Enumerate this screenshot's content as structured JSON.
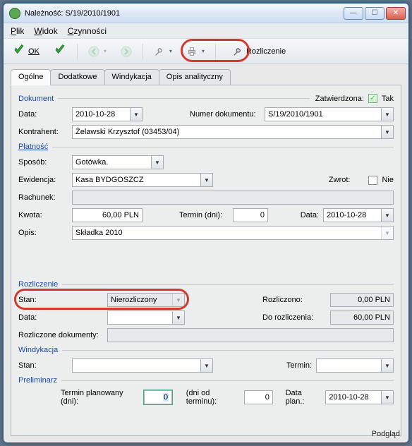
{
  "window": {
    "title": "Należność: S/19/2010/1901"
  },
  "menu": {
    "plik": "Plik",
    "widok": "Widok",
    "czynnosci": "Czynności"
  },
  "toolbar": {
    "ok": "OK",
    "rozliczenie": "Rozliczenie"
  },
  "tabs": {
    "ogolne": "Ogólne",
    "dodatkowe": "Dodatkowe",
    "windykacja": "Windykacja",
    "opis": "Opis analityczny"
  },
  "dokument": {
    "title": "Dokument",
    "zatw_label": "Zatwierdzona:",
    "zatw_tak": "Tak",
    "data_label": "Data:",
    "data_value": "2010-10-28",
    "numdok_label": "Numer dokumentu:",
    "numdok_value": "S/19/2010/1901",
    "kontrahent_label": "Kontrahent:",
    "kontrahent_value": "Żelawski Krzysztof (03453/04)"
  },
  "platnosc": {
    "title": "Płatność",
    "sposob_label": "Sposób:",
    "sposob_value": "Gotówka.",
    "ewid_label": "Ewidencja:",
    "ewid_value": "Kasa BYDGOSZCZ",
    "zwrot_label": "Zwrot:",
    "zwrot_nie": "Nie",
    "rachunek_label": "Rachunek:",
    "kwota_label": "Kwota:",
    "kwota_value": "60,00 PLN",
    "termin_label": "Termin (dni):",
    "termin_value": "0",
    "data_label": "Data:",
    "data_value": "2010-10-28",
    "opis_label": "Opis:",
    "opis_value": "Składka 2010"
  },
  "rozliczenie": {
    "title": "Rozliczenie",
    "stan_label": "Stan:",
    "stan_value": "Nierozliczony",
    "rozliczono_label": "Rozliczono:",
    "rozliczono_value": "0,00 PLN",
    "data_label": "Data:",
    "dorozl_label": "Do rozliczenia:",
    "dorozl_value": "60,00 PLN",
    "rozldok_label": "Rozliczone dokumenty:"
  },
  "wind": {
    "title": "Windykacja",
    "stan_label": "Stan:",
    "termin_label": "Termin:"
  },
  "prelim": {
    "title": "Preliminarz",
    "termin_plan_label": "Termin planowany (dni):",
    "termin_plan_value": "0",
    "dni_od_label": "(dni od terminu):",
    "dni_od_value": "0",
    "dataplan_label": "Data plan.:",
    "dataplan_value": "2010-10-28"
  },
  "footer": {
    "podglad": "Podgląd"
  },
  "chart_data": {
    "type": "table",
    "title": "Należność detail form",
    "records": [
      {
        "field": "Data",
        "value": "2010-10-28"
      },
      {
        "field": "Numer dokumentu",
        "value": "S/19/2010/1901"
      },
      {
        "field": "Kontrahent",
        "value": "Żelawski Krzysztof (03453/04)"
      },
      {
        "field": "Sposób",
        "value": "Gotówka."
      },
      {
        "field": "Ewidencja",
        "value": "Kasa BYDGOSZCZ"
      },
      {
        "field": "Kwota",
        "value": "60,00 PLN"
      },
      {
        "field": "Termin (dni)",
        "value": 0
      },
      {
        "field": "Data płatności",
        "value": "2010-10-28"
      },
      {
        "field": "Opis",
        "value": "Składka 2010"
      },
      {
        "field": "Stan",
        "value": "Nierozliczony"
      },
      {
        "field": "Rozliczono",
        "value": "0,00 PLN"
      },
      {
        "field": "Do rozliczenia",
        "value": "60,00 PLN"
      },
      {
        "field": "Data plan.",
        "value": "2010-10-28"
      }
    ]
  }
}
